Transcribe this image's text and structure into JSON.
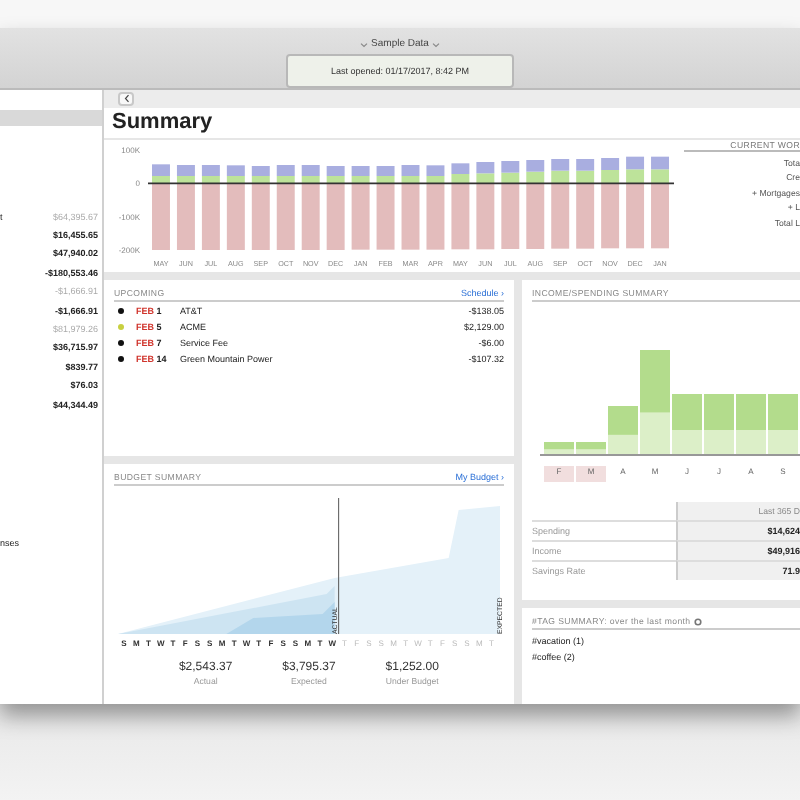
{
  "window": {
    "title": "Sample Data",
    "last_opened": "Last opened: 01/17/2017, 8:42 PM"
  },
  "sidebar": {
    "items": [
      {
        "label": "t",
        "amount": "$64,395.67",
        "dimmed": true
      },
      {
        "amount": "$16,455.65",
        "dimmed": false
      },
      {
        "amount": "$47,940.02",
        "dimmed": false
      },
      {
        "amount": "-$180,553.46",
        "dimmed": false
      },
      {
        "amount": "-$1,666.91",
        "dimmed": true
      },
      {
        "amount": "-$1,666.91",
        "dimmed": false
      },
      {
        "amount": "$81,979.26",
        "dimmed": true
      },
      {
        "amount": "$36,715.97",
        "dimmed": false
      },
      {
        "amount": "$839.77",
        "dimmed": false
      },
      {
        "amount": "$76.03",
        "dimmed": false
      },
      {
        "amount": "$44,344.49",
        "dimmed": false
      }
    ],
    "footer_label": "nses"
  },
  "page_title": "Summary",
  "net_worth_chart": {
    "chart_data": {
      "type": "bar",
      "stacked": true,
      "categories": [
        "MAY",
        "JUN",
        "JUL",
        "AUG",
        "SEP",
        "OCT",
        "NOV",
        "DEC",
        "JAN",
        "FEB",
        "MAR",
        "APR",
        "MAY",
        "JUN",
        "JUL",
        "AUG",
        "SEP",
        "OCT",
        "NOV",
        "DEC",
        "JAN"
      ],
      "ylim": [
        -200000,
        100000
      ],
      "yticks": [
        {
          "value": 100000,
          "label": "100K"
        },
        {
          "value": 0,
          "label": "0"
        },
        {
          "value": -100000,
          "label": "-100K"
        },
        {
          "value": -200000,
          "label": "-200K"
        }
      ],
      "series": [
        {
          "color": "#bde39a",
          "values": [
            22000,
            22000,
            22000,
            22000,
            22000,
            22000,
            22000,
            22000,
            22000,
            22000,
            22000,
            22000,
            28000,
            30000,
            32000,
            35000,
            38000,
            38000,
            40000,
            42000,
            42000
          ]
        },
        {
          "color": "#a9aee0",
          "values": [
            35000,
            33000,
            33000,
            32000,
            30000,
            33000,
            33000,
            30000,
            30000,
            30000,
            33000,
            32000,
            32000,
            34000,
            35000,
            35000,
            35000,
            35000,
            36000,
            38000,
            38000
          ]
        },
        {
          "color": "#e3bcbc",
          "values": [
            -200000,
            -200000,
            -200000,
            -200000,
            -200000,
            -200000,
            -200000,
            -200000,
            -199000,
            -199000,
            -199000,
            -199000,
            -198000,
            -198000,
            -197000,
            -197000,
            -196000,
            -196000,
            -195000,
            -195000,
            -195000
          ]
        }
      ]
    }
  },
  "current_worth": {
    "title": "CURRENT WOR",
    "lines": [
      "Tota",
      "Cre",
      "+ Mortgages",
      "+ L",
      "Total L"
    ]
  },
  "upcoming": {
    "title": "UPCOMING",
    "link": "Schedule ›",
    "items": [
      {
        "month": "FEB",
        "day": "1",
        "payee": "AT&T",
        "amount": "-$138.05",
        "color": "#111111"
      },
      {
        "month": "FEB",
        "day": "5",
        "payee": "ACME",
        "amount": "$2,129.00",
        "color": "#c8d040"
      },
      {
        "month": "FEB",
        "day": "7",
        "payee": "Service Fee",
        "amount": "-$6.00",
        "color": "#111111"
      },
      {
        "month": "FEB",
        "day": "14",
        "payee": "Green Mountain Power",
        "amount": "-$107.32",
        "color": "#111111"
      }
    ]
  },
  "budget": {
    "title": "BUDGET SUMMARY",
    "link": "My Budget ›",
    "actual_marker": "ACTUAL",
    "expected_marker": "EXPECTED",
    "days": [
      {
        "letter": "S",
        "past": true
      },
      {
        "letter": "M",
        "past": true
      },
      {
        "letter": "T",
        "past": true
      },
      {
        "letter": "W",
        "past": true
      },
      {
        "letter": "T",
        "past": true
      },
      {
        "letter": "F",
        "past": true
      },
      {
        "letter": "S",
        "past": true
      },
      {
        "letter": "S",
        "past": true
      },
      {
        "letter": "M",
        "past": true
      },
      {
        "letter": "T",
        "past": true
      },
      {
        "letter": "W",
        "past": true
      },
      {
        "letter": "T",
        "past": true
      },
      {
        "letter": "F",
        "past": true
      },
      {
        "letter": "S",
        "past": true
      },
      {
        "letter": "S",
        "past": true
      },
      {
        "letter": "M",
        "past": true
      },
      {
        "letter": "T",
        "past": true
      },
      {
        "letter": "W",
        "past": true
      },
      {
        "letter": "T",
        "past": false
      },
      {
        "letter": "F",
        "past": false
      },
      {
        "letter": "S",
        "past": false
      },
      {
        "letter": "S",
        "past": false
      },
      {
        "letter": "M",
        "past": false
      },
      {
        "letter": "T",
        "past": false
      },
      {
        "letter": "W",
        "past": false
      },
      {
        "letter": "T",
        "past": false
      },
      {
        "letter": "F",
        "past": false
      },
      {
        "letter": "S",
        "past": false
      },
      {
        "letter": "S",
        "past": false
      },
      {
        "letter": "M",
        "past": false
      },
      {
        "letter": "T",
        "past": false
      }
    ],
    "totals": [
      {
        "value": "$2,543.37",
        "label": "Actual"
      },
      {
        "value": "$3,795.37",
        "label": "Expected"
      },
      {
        "value": "$1,252.00",
        "label": "Under Budget"
      }
    ]
  },
  "income_spending": {
    "title": "INCOME/SPENDING SUMMARY",
    "months": [
      "F",
      "M",
      "A",
      "M",
      "J",
      "J",
      "A",
      "S"
    ],
    "table_header": "Last 365 D",
    "rows": [
      {
        "label": "Spending",
        "value": "$14,624"
      },
      {
        "label": "Income",
        "value": "$49,916"
      },
      {
        "label": "Savings Rate",
        "value": "71.9"
      }
    ]
  },
  "tag_summary": {
    "title": "#TAG SUMMARY: over the last month",
    "tags": [
      "#vacation (1)",
      "#coffee (2)"
    ]
  }
}
